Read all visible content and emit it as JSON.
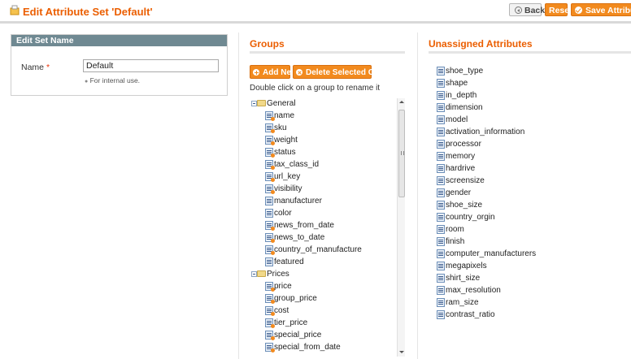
{
  "header": {
    "title": "Edit Attribute Set 'Default'",
    "back_label": "Back",
    "reset_label": "Reset",
    "save_label": "Save Attribute Se"
  },
  "edit_set": {
    "heading": "Edit Set Name",
    "name_label": "Name",
    "required_mark": "*",
    "name_value": "Default",
    "note": "For internal use."
  },
  "groups": {
    "title": "Groups",
    "add_new_label": "Add New",
    "delete_label": "Delete Selected Group",
    "hint": "Double click on a group to rename it",
    "tree": [
      {
        "type": "group",
        "label": "General"
      },
      {
        "type": "attr",
        "label": "name",
        "system": true
      },
      {
        "type": "attr",
        "label": "sku",
        "system": true
      },
      {
        "type": "attr",
        "label": "weight",
        "system": true
      },
      {
        "type": "attr",
        "label": "status",
        "system": true
      },
      {
        "type": "attr",
        "label": "tax_class_id",
        "system": true
      },
      {
        "type": "attr",
        "label": "url_key",
        "system": true
      },
      {
        "type": "attr",
        "label": "visibility",
        "system": true
      },
      {
        "type": "attr",
        "label": "manufacturer",
        "system": false
      },
      {
        "type": "attr",
        "label": "color",
        "system": false
      },
      {
        "type": "attr",
        "label": "news_from_date",
        "system": true
      },
      {
        "type": "attr",
        "label": "news_to_date",
        "system": true
      },
      {
        "type": "attr",
        "label": "country_of_manufacture",
        "system": true
      },
      {
        "type": "attr",
        "label": "featured",
        "system": false
      },
      {
        "type": "group",
        "label": "Prices"
      },
      {
        "type": "attr",
        "label": "price",
        "system": true
      },
      {
        "type": "attr",
        "label": "group_price",
        "system": true
      },
      {
        "type": "attr",
        "label": "cost",
        "system": true
      },
      {
        "type": "attr",
        "label": "tier_price",
        "system": true
      },
      {
        "type": "attr",
        "label": "special_price",
        "system": true
      },
      {
        "type": "attr",
        "label": "special_from_date",
        "system": true
      }
    ]
  },
  "unassigned": {
    "title": "Unassigned Attributes",
    "items": [
      "shoe_type",
      "shape",
      "in_depth",
      "dimension",
      "model",
      "activation_information",
      "processor",
      "memory",
      "hardrive",
      "screensize",
      "gender",
      "shoe_size",
      "country_orgin",
      "room",
      "finish",
      "computer_manufacturers",
      "megapixels",
      "shirt_size",
      "max_resolution",
      "ram_size",
      "contrast_ratio"
    ]
  },
  "colors": {
    "accent": "#eb5e00",
    "button": "#f28a1e",
    "panel_header": "#6f8992"
  }
}
